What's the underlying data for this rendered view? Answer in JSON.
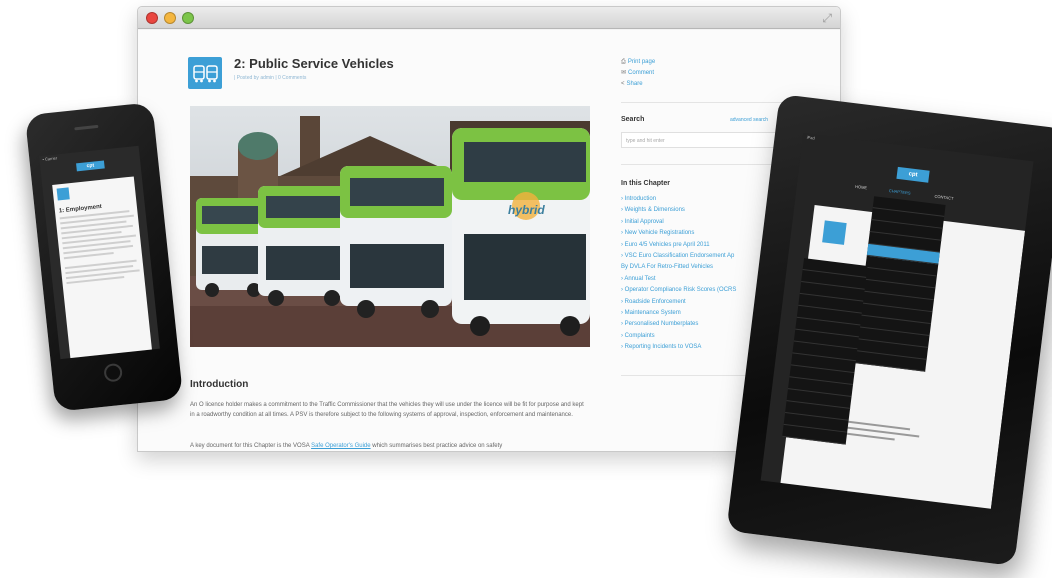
{
  "desktop": {
    "post": {
      "title": "2: Public Service Vehicles",
      "meta": "| Posted by admin | 0 Comments"
    },
    "sidebar": {
      "actions": [
        {
          "icon": "print-icon",
          "label": "Print page"
        },
        {
          "icon": "comment-icon",
          "label": "Comment"
        },
        {
          "icon": "share-icon",
          "label": "Share"
        }
      ],
      "search_heading": "Search",
      "advanced_search": "advanced search",
      "search_placeholder": "type and hit enter",
      "chapter_heading": "In this Chapter",
      "chapter_items": [
        "Introduction",
        "Weights & Dimensions",
        "Initial Approval",
        "New Vehicle Registrations",
        "Euro 4/5 Vehicles pre April 2011",
        "VSC Euro Classification Endorsement Ap",
        "By DVLA For Retro-Fitted Vehicles",
        "Annual Test",
        "Operator Compliance Risk Scores (OCRS",
        "Roadside Enforcement",
        "Maintenance System",
        "Personalised Numberplates",
        "Complaints",
        "Reporting Incidents to VOSA"
      ]
    },
    "content": {
      "intro_heading": "Introduction",
      "intro_text": "An O licence holder makes a commitment to the Traffic Commissioner that the vehicles they will use under the licence will be fit for purpose and kept in a roadworthy condition at all times. A PSV is therefore subject to the following systems of approval, inspection, enforcement and maintenance.",
      "intro_text2_before": "A key document for this Chapter is the VOSA ",
      "intro_link": "Safe Operator's Guide",
      "intro_text2_after": " which summarises best practice advice on safety"
    },
    "bus_livery_text": "hybrid"
  },
  "phone": {
    "status": "• Carrier",
    "logo": "cpt",
    "heading": "1: Employment"
  },
  "tablet": {
    "status": "iPad",
    "logo": "cpt",
    "nav": [
      "HOME",
      "CHAPTERS",
      "CONTACT"
    ]
  },
  "colors": {
    "accent": "#3c9fd6",
    "bus_green": "#7cc243",
    "title_text": "#333333"
  }
}
